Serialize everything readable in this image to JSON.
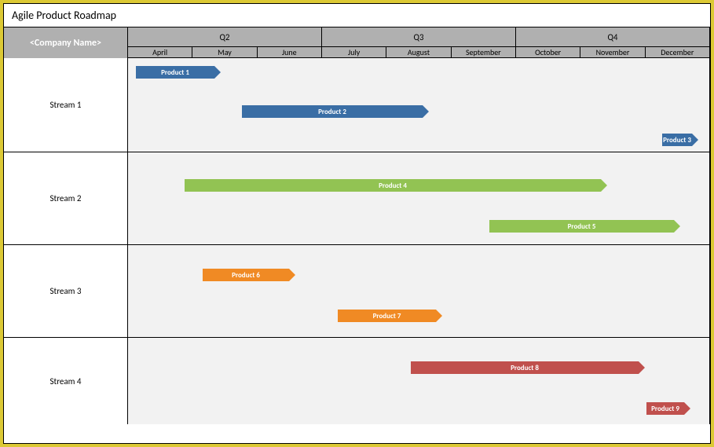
{
  "title": "Agile Product Roadmap",
  "company_label": "<Company Name>",
  "quarters": [
    "Q2",
    "Q3",
    "Q4"
  ],
  "months": [
    "April",
    "May",
    "June",
    "July",
    "August",
    "September",
    "October",
    "November",
    "December"
  ],
  "streams": [
    "Stream 1",
    "Stream 2",
    "Stream 3",
    "Stream 4"
  ],
  "chart_data": {
    "type": "gantt",
    "x_axis": {
      "unit": "month",
      "range": [
        "April",
        "December"
      ]
    },
    "rows": [
      {
        "stream": "Stream 1",
        "bars": [
          {
            "label": "Product 1",
            "start": "April",
            "end": "May",
            "color": "#3a6ea5"
          },
          {
            "label": "Product 2",
            "start": "June",
            "end": "August",
            "color": "#3a6ea5"
          },
          {
            "label": "Product 3",
            "start": "December",
            "end": "December",
            "color": "#3a6ea5"
          }
        ]
      },
      {
        "stream": "Stream 2",
        "bars": [
          {
            "label": "Product 4",
            "start": "May",
            "end": "October",
            "color": "#92c353"
          },
          {
            "label": "Product 5",
            "start": "September",
            "end": "November",
            "color": "#92c353"
          }
        ]
      },
      {
        "stream": "Stream 3",
        "bars": [
          {
            "label": "Product 6",
            "start": "May",
            "end": "June",
            "color": "#f08a24"
          },
          {
            "label": "Product 7",
            "start": "July",
            "end": "August",
            "color": "#f08a24"
          }
        ]
      },
      {
        "stream": "Stream 4",
        "bars": [
          {
            "label": "Product 8",
            "start": "August",
            "end": "November",
            "color": "#c0504d"
          },
          {
            "label": "Product 9",
            "start": "December",
            "end": "December",
            "color": "#c0504d"
          }
        ]
      }
    ]
  }
}
